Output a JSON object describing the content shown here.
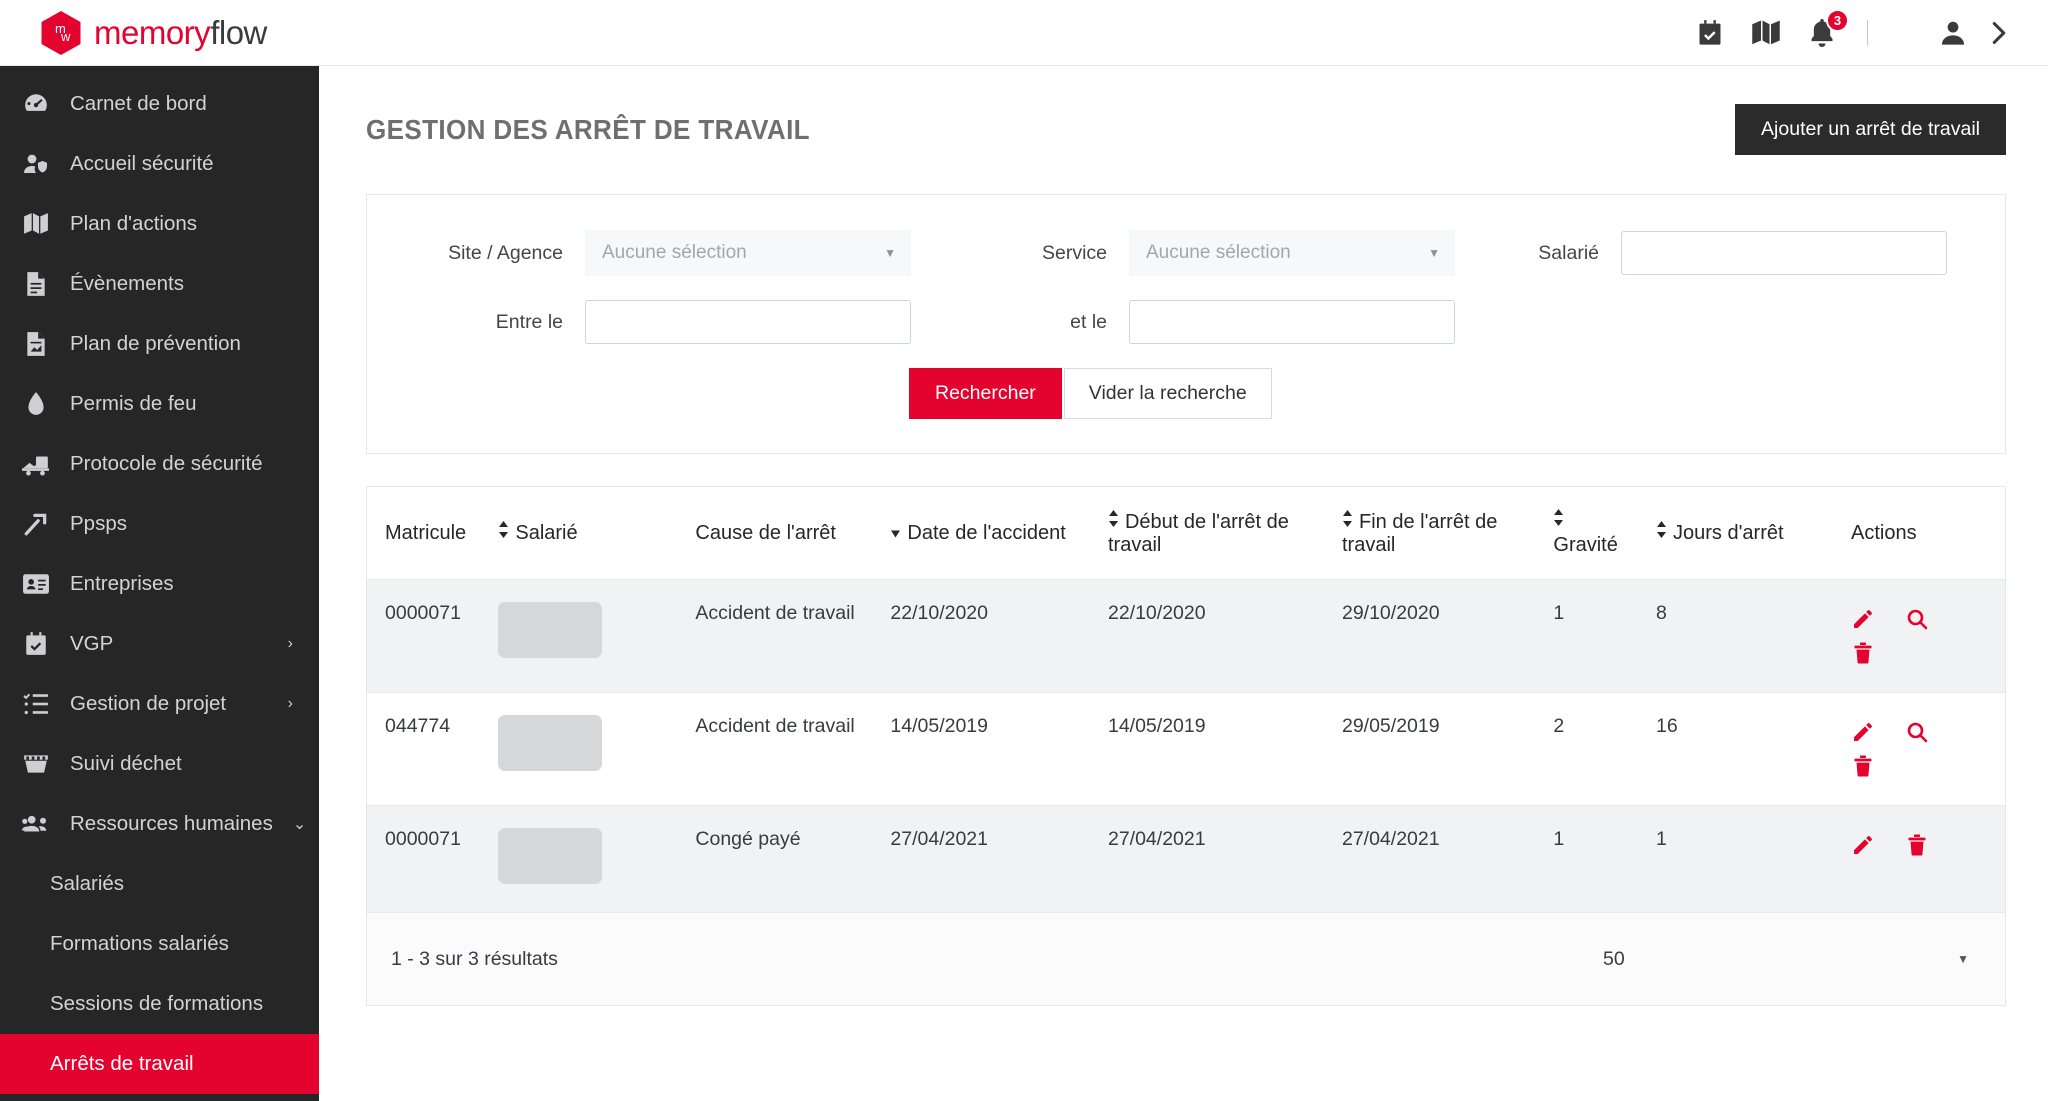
{
  "brand": {
    "logo_mark": "mw",
    "name_part1": "memory",
    "name_part2": "flow"
  },
  "topbar": {
    "icons": [
      {
        "name": "calendar-check-icon"
      },
      {
        "name": "map-icon"
      },
      {
        "name": "bell-icon",
        "badge": "3"
      }
    ],
    "user_icon": "user-icon",
    "expand_icon": "chevron-right-icon"
  },
  "sidebar": {
    "items": [
      {
        "label": "Carnet de bord",
        "icon": "dashboard-icon",
        "caret": ""
      },
      {
        "label": "Accueil sécurité",
        "icon": "user-shield-icon",
        "caret": ""
      },
      {
        "label": "Plan d'actions",
        "icon": "map-folded-icon",
        "caret": ""
      },
      {
        "label": "Évènements",
        "icon": "document-icon",
        "caret": ""
      },
      {
        "label": "Plan de prévention",
        "icon": "document-chart-icon",
        "caret": ""
      },
      {
        "label": "Permis de feu",
        "icon": "flame-icon",
        "caret": ""
      },
      {
        "label": "Protocole de sécurité",
        "icon": "truck-icon",
        "caret": ""
      },
      {
        "label": "Ppsps",
        "icon": "hammer-icon",
        "caret": ""
      },
      {
        "label": "Entreprises",
        "icon": "id-card-icon",
        "caret": ""
      },
      {
        "label": "VGP",
        "icon": "calendar-check-icon",
        "caret": "›"
      },
      {
        "label": "Gestion de projet",
        "icon": "task-list-icon",
        "caret": "›"
      },
      {
        "label": "Suivi déchet",
        "icon": "dumpster-icon",
        "caret": ""
      },
      {
        "label": "Ressources humaines",
        "icon": "users-icon",
        "caret": "⌄"
      }
    ],
    "subitems": [
      {
        "label": "Salariés",
        "active": false
      },
      {
        "label": "Formations salariés",
        "active": false
      },
      {
        "label": "Sessions de formations",
        "active": false
      },
      {
        "label": "Arrêts de travail",
        "active": true
      }
    ],
    "active_color": "#e4032e"
  },
  "page": {
    "title": "GESTION DES ARRÊT DE TRAVAIL",
    "add_button": "Ajouter un arrêt de travail"
  },
  "filters": {
    "site_label": "Site / Agence",
    "site_value": "Aucune sélection",
    "service_label": "Service",
    "service_value": "Aucune sélection",
    "salarie_label": "Salarié",
    "salarie_value": "",
    "salarie_placeholder": "",
    "date_from_label": "Entre le",
    "date_from_value": "",
    "date_from_placeholder": "",
    "date_to_label": "et le",
    "date_to_value": "",
    "date_to_placeholder": "",
    "search_button": "Rechercher",
    "clear_button": "Vider la recherche",
    "accent_color": "#e4032e"
  },
  "table": {
    "columns": [
      {
        "label": "Matricule",
        "sort": "none"
      },
      {
        "label": "Salarié",
        "sort": "both"
      },
      {
        "label": "Cause de l'arrêt",
        "sort": "none"
      },
      {
        "label": "Date de l'accident",
        "sort": "desc"
      },
      {
        "label": "Début de l'arrêt de travail",
        "sort": "both"
      },
      {
        "label": "Fin de l'arrêt de travail",
        "sort": "both"
      },
      {
        "label": "Gravité",
        "sort": "both"
      },
      {
        "label": "Jours d'arrêt",
        "sort": "both"
      },
      {
        "label": "Actions",
        "sort": "none"
      }
    ],
    "rows": [
      {
        "matricule": "0000071",
        "salarie": "",
        "cause": "Accident de travail",
        "date_accident": "22/10/2020",
        "debut": "22/10/2020",
        "fin": "29/10/2020",
        "gravite": "1",
        "jours": "8",
        "actions": [
          "edit-icon",
          "search-icon",
          "delete-icon"
        ]
      },
      {
        "matricule": "044774",
        "salarie": "",
        "cause": "Accident de travail",
        "date_accident": "14/05/2019",
        "debut": "14/05/2019",
        "fin": "29/05/2019",
        "gravite": "2",
        "jours": "16",
        "actions": [
          "edit-icon",
          "search-icon",
          "delete-icon"
        ]
      },
      {
        "matricule": "0000071",
        "salarie": "",
        "cause": "Congé payé",
        "date_accident": "27/04/2021",
        "debut": "27/04/2021",
        "fin": "27/04/2021",
        "gravite": "1",
        "jours": "1",
        "actions": [
          "edit-icon",
          "delete-icon"
        ]
      }
    ],
    "footer": {
      "count_text": "1 - 3 sur 3 résultats",
      "page_size": "50"
    }
  }
}
